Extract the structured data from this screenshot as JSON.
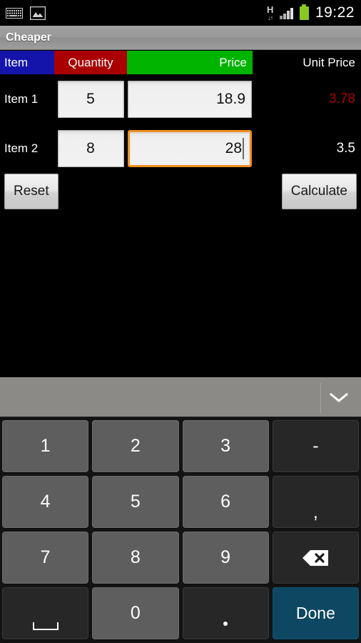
{
  "status_bar": {
    "icons_left": [
      "keyboard-icon",
      "picture-icon"
    ],
    "network_type": "H",
    "network_arrows": "↓↑",
    "signal_icon": "signal-bars-icon",
    "battery_icon": "battery-full-icon",
    "battery_color": "#8ac722",
    "time": "19:22"
  },
  "action_bar": {
    "title": "Cheaper"
  },
  "table": {
    "headers": {
      "item": "Item",
      "quantity": "Quantity",
      "price": "Price",
      "unit_price": "Unit Price"
    },
    "header_colors": {
      "item": "#1414ab",
      "quantity": "#aa0000",
      "price": "#00b400",
      "unit_price": "#000000"
    },
    "rows": [
      {
        "label": "Item 1",
        "quantity": "5",
        "price": "18.9",
        "unit_price": "3.78",
        "unit_price_color": "#aa0000",
        "focused_field": ""
      },
      {
        "label": "Item 2",
        "quantity": "8",
        "price": "28",
        "unit_price": "3.5",
        "unit_price_color": "#ffffff",
        "focused_field": "price"
      }
    ]
  },
  "buttons": {
    "reset_label": "Reset",
    "calculate_label": "Calculate"
  },
  "keyboard": {
    "hide_icon": "chevron-down-icon",
    "rows": [
      [
        {
          "label": "1",
          "type": "num",
          "icon": ""
        },
        {
          "label": "2",
          "type": "num",
          "icon": ""
        },
        {
          "label": "3",
          "type": "num",
          "icon": ""
        },
        {
          "label": "-",
          "type": "fn",
          "icon": ""
        }
      ],
      [
        {
          "label": "4",
          "type": "num",
          "icon": ""
        },
        {
          "label": "5",
          "type": "num",
          "icon": ""
        },
        {
          "label": "6",
          "type": "num",
          "icon": ""
        },
        {
          "label": ",",
          "type": "fn",
          "icon": ""
        }
      ],
      [
        {
          "label": "7",
          "type": "num",
          "icon": ""
        },
        {
          "label": "8",
          "type": "num",
          "icon": ""
        },
        {
          "label": "9",
          "type": "num",
          "icon": ""
        },
        {
          "label": "",
          "type": "fn",
          "icon": "backspace-icon"
        }
      ],
      [
        {
          "label": "",
          "type": "fn",
          "icon": "space-icon"
        },
        {
          "label": "0",
          "type": "num",
          "icon": ""
        },
        {
          "label": ".",
          "type": "fn",
          "icon": "period-icon"
        },
        {
          "label": "Done",
          "type": "done",
          "icon": ""
        }
      ]
    ],
    "done_color": "#0d4761"
  }
}
